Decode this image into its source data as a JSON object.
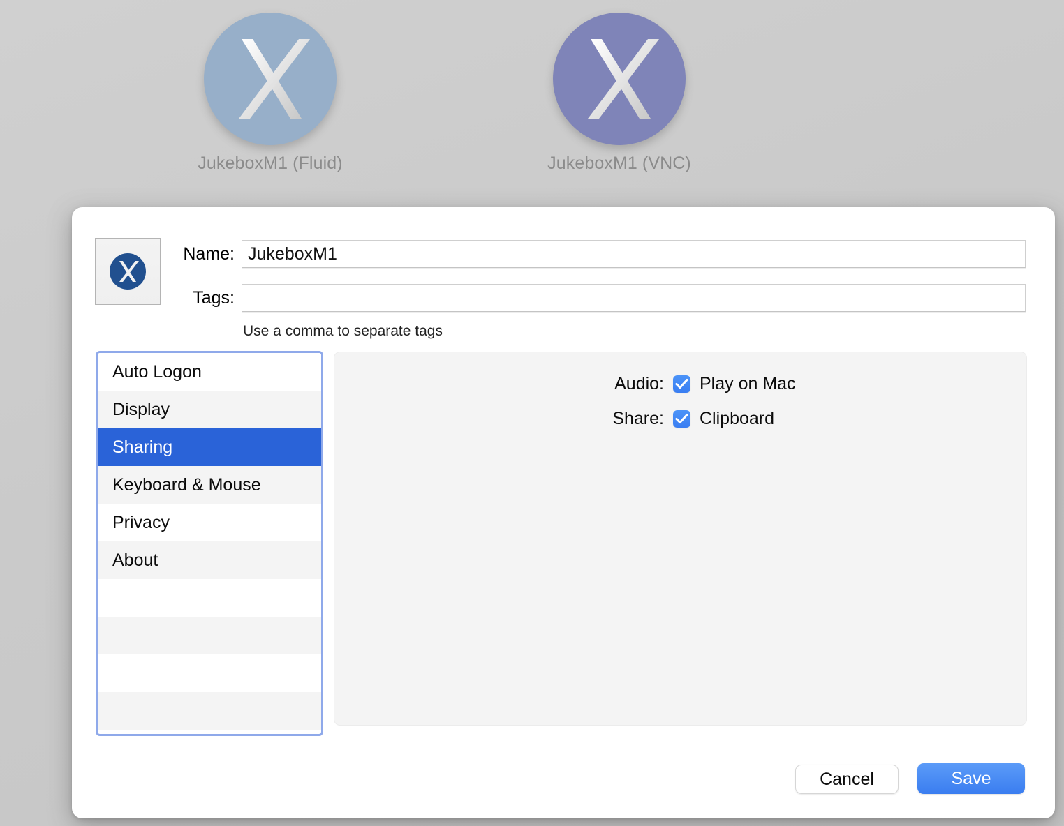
{
  "desktop": {
    "icons": [
      {
        "label": "JukeboxM1 (Fluid)",
        "color": "#97afc9",
        "glyph": "x-logo-icon"
      },
      {
        "label": "JukeboxM1 (VNC)",
        "color": "#7f84b8",
        "glyph": "x-logo-icon"
      }
    ]
  },
  "dialog": {
    "thumbnail": {
      "icon": "x-logo-icon",
      "color": "#21508f"
    },
    "fields": {
      "name_label": "Name:",
      "name_value": "JukeboxM1",
      "name_placeholder": "",
      "tags_label": "Tags:",
      "tags_value": "",
      "tags_placeholder": "",
      "tags_hint": "Use a comma to separate tags"
    },
    "sidebar": {
      "items": [
        {
          "label": "Auto Logon",
          "selected": false
        },
        {
          "label": "Display",
          "selected": false
        },
        {
          "label": "Sharing",
          "selected": true
        },
        {
          "label": "Keyboard & Mouse",
          "selected": false
        },
        {
          "label": "Privacy",
          "selected": false
        },
        {
          "label": "About",
          "selected": false
        },
        {
          "label": "",
          "selected": false
        },
        {
          "label": "",
          "selected": false
        },
        {
          "label": "",
          "selected": false
        },
        {
          "label": "",
          "selected": false
        }
      ],
      "selection_color": "#2a63d8",
      "focus_ring_color": "#8fa9ea"
    },
    "panel": {
      "options": [
        {
          "label": "Audio:",
          "checkbox_label": "Play on Mac",
          "checked": true
        },
        {
          "label": "Share:",
          "checkbox_label": "Clipboard",
          "checked": true
        }
      ],
      "checkbox_color": "#3a7ef2"
    },
    "footer": {
      "cancel_label": "Cancel",
      "save_label": "Save",
      "save_color": "#3a7df0"
    }
  }
}
